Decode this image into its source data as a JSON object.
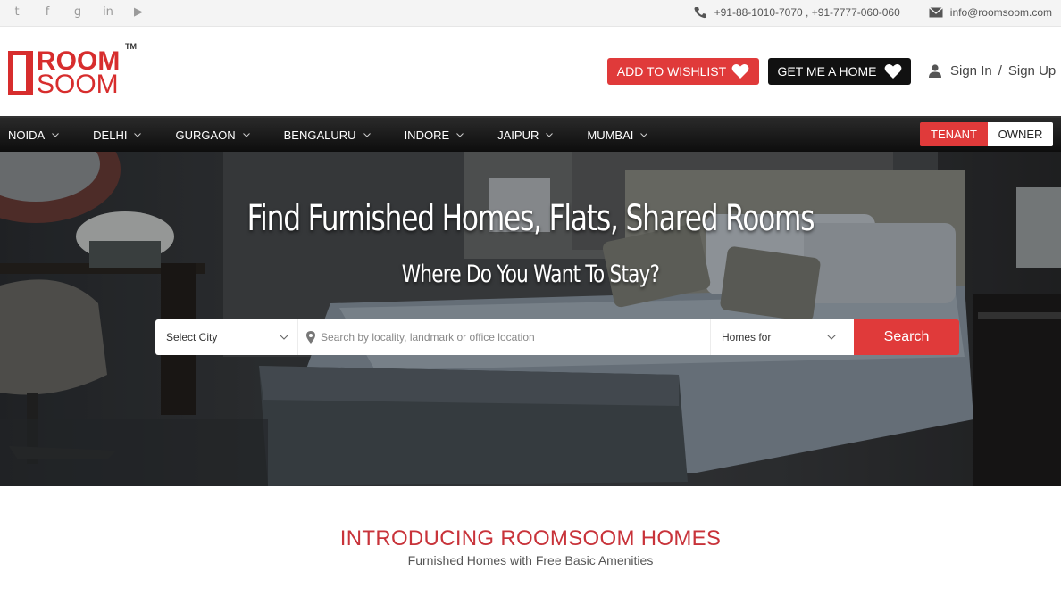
{
  "topbar": {
    "social_icons": [
      "twitter-icon",
      "facebook-icon",
      "google-plus-icon",
      "linkedin-icon",
      "youtube-icon"
    ],
    "social_glyphs": [
      "t",
      "f",
      "g",
      "in",
      "▶"
    ],
    "phone": "+91-88-1010-7070 , +91-7777-060-060",
    "email": "info@roomsoom.com"
  },
  "header": {
    "logo_line1": "ROOM",
    "logo_line2": "SOOM",
    "logo_tm": "TM",
    "wishlist_label": "ADD TO WISHLIST",
    "get_home_label": "GET ME A HOME",
    "sign_in": "Sign In",
    "separator": "/",
    "sign_up": "Sign Up"
  },
  "nav": {
    "items": [
      {
        "label": "NOIDA"
      },
      {
        "label": "DELHI"
      },
      {
        "label": "GURGAON"
      },
      {
        "label": "BENGALURU"
      },
      {
        "label": "INDORE"
      },
      {
        "label": "JAIPUR"
      },
      {
        "label": "MUMBAI"
      }
    ],
    "tenant_label": "TENANT",
    "owner_label": "OWNER"
  },
  "hero": {
    "title": "Find Furnished Homes, Flats, Shared Rooms",
    "subtitle": "Where Do You Want To Stay?",
    "search": {
      "city_selected": "Select City",
      "location_placeholder": "Search by locality, landmark or office location",
      "location_value": "",
      "homes_for_selected": "Homes for",
      "button_label": "Search"
    }
  },
  "intro": {
    "title": "INTRODUCING ROOMSOOM HOMES",
    "subtitle": "Furnished Homes with Free Basic Amenities"
  },
  "colors": {
    "brand_red": "#e03a3a",
    "logo_red": "#d72d2d",
    "intro_red": "#c8333a",
    "nav_black": "#111111"
  }
}
